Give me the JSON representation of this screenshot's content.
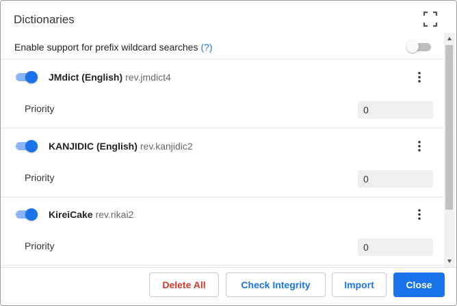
{
  "dialog": {
    "title": "Dictionaries",
    "fullscreen_icon": "fullscreen-icon"
  },
  "settings": {
    "wildcard_label": "Enable support for prefix wildcard searches",
    "help_text": "(?)",
    "wildcard_enabled": false
  },
  "dictionaries": [
    {
      "title": "JMdict (English)",
      "revision": "rev.jmdict4",
      "enabled": true,
      "priority_label": "Priority",
      "priority": "0"
    },
    {
      "title": "KANJIDIC (English)",
      "revision": "rev.kanjidic2",
      "enabled": true,
      "priority_label": "Priority",
      "priority": "0"
    },
    {
      "title": "KireiCake",
      "revision": "rev.rikai2",
      "enabled": true,
      "priority_label": "Priority",
      "priority": "0"
    }
  ],
  "footer": {
    "delete_all": "Delete All",
    "check_integrity": "Check Integrity",
    "import": "Import",
    "close": "Close"
  },
  "colors": {
    "accent": "#1a73e8",
    "danger": "#d0392b"
  }
}
